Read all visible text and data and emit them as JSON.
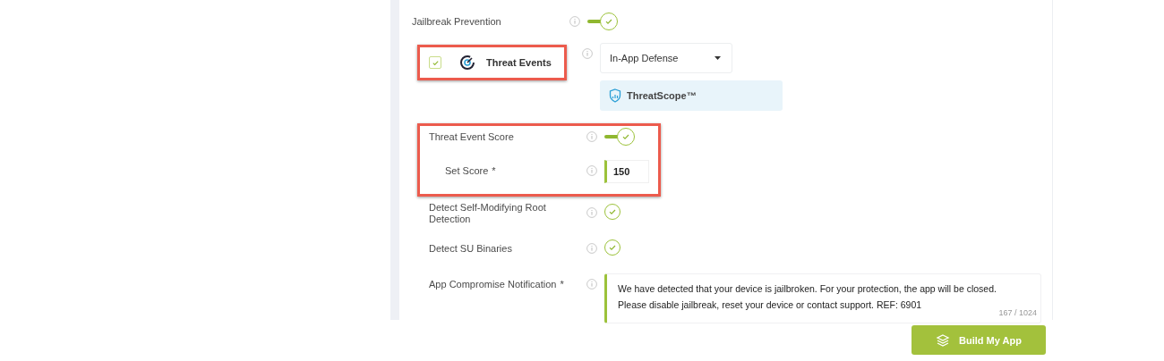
{
  "sections": [
    {
      "highlighted": false,
      "rows": [
        {
          "kind": "toggle",
          "label": "Jailbreak Prevention",
          "on": true
        }
      ]
    },
    {
      "highlighted": true,
      "rows": [
        {
          "kind": "checkbox",
          "label": "Threat Events",
          "checked": true,
          "select": {
            "value": "In-App Defense"
          },
          "badge": "ThreatScope™"
        }
      ]
    },
    {
      "highlighted": true,
      "rows": [
        {
          "kind": "toggle",
          "label": "Threat Event Score",
          "on": true
        },
        {
          "kind": "input",
          "label": "Set Score",
          "required_mark": "*",
          "value": "150"
        }
      ]
    },
    {
      "highlighted": false,
      "rows": [
        {
          "kind": "check",
          "label": "Detect Self-Modifying Root Detection",
          "checked": true
        },
        {
          "kind": "check",
          "label": "Detect SU Binaries",
          "checked": true
        },
        {
          "kind": "textarea",
          "label": "App Compromise Notification",
          "required_mark": "*",
          "value": "We have detected that your device is jailbroken. For your protection, the app will be closed. Please disable jailbreak, reset your device or contact support. REF: 6901",
          "counter": "167 / 1024"
        }
      ]
    }
  ],
  "build_button": {
    "label": "Build My App"
  }
}
